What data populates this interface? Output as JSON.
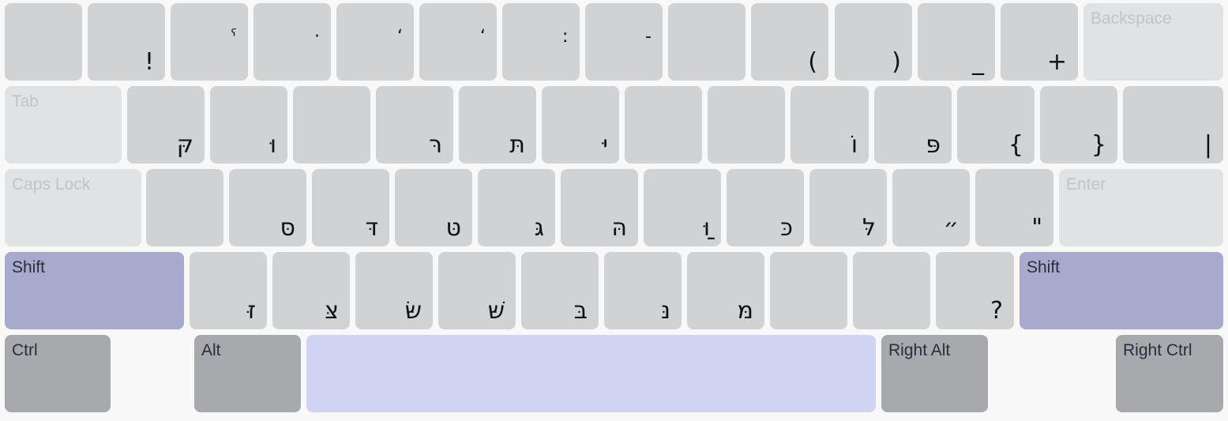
{
  "keyboard": {
    "colors": {
      "background": "#f8f8f8",
      "key": "#d1d2d4",
      "function_key": "#e1e2e4",
      "shift_key": "#a8aacd",
      "modifier_key": "#a8a9ac",
      "space_key": "#d0d3f1"
    },
    "rows": [
      {
        "name": "number-row",
        "keys": [
          {
            "char": ""
          },
          {
            "char": "!"
          },
          {
            "char": "ˁ"
          },
          {
            "char": "·"
          },
          {
            "char": "ʻ"
          },
          {
            "char": "ʻ"
          },
          {
            "char": "ː"
          },
          {
            "char": "-"
          },
          {
            "char": ""
          },
          {
            "char": "("
          },
          {
            "char": ")"
          },
          {
            "char": "_"
          },
          {
            "char": "+"
          },
          {
            "label": "Backspace"
          }
        ]
      },
      {
        "name": "top-row",
        "keys": [
          {
            "label": "Tab"
          },
          {
            "char": "קּ"
          },
          {
            "char": "וּ"
          },
          {
            "char": ""
          },
          {
            "char": "רּ"
          },
          {
            "char": "תּ"
          },
          {
            "char": "יּ"
          },
          {
            "char": ""
          },
          {
            "char": ""
          },
          {
            "char": "ֹו"
          },
          {
            "char": "פּ"
          },
          {
            "char": "{"
          },
          {
            "char": "}"
          },
          {
            "char": "|"
          }
        ]
      },
      {
        "name": "home-row",
        "keys": [
          {
            "label": "Caps Lock"
          },
          {
            "char": ""
          },
          {
            "char": "סּ"
          },
          {
            "char": "דּ"
          },
          {
            "char": "טּ"
          },
          {
            "char": "גּ"
          },
          {
            "char": "הּ"
          },
          {
            "char": "ַוּ"
          },
          {
            "char": "כּ"
          },
          {
            "char": "לּ"
          },
          {
            "char": "״"
          },
          {
            "char": "\""
          },
          {
            "label": "Enter"
          }
        ]
      },
      {
        "name": "bottom-row",
        "keys": [
          {
            "label": "Shift"
          },
          {
            "char": "זּ"
          },
          {
            "char": "צּ"
          },
          {
            "char": "שּׂ"
          },
          {
            "char": "שּׁ"
          },
          {
            "char": "בּ"
          },
          {
            "char": "נּ"
          },
          {
            "char": "מּ"
          },
          {
            "char": ""
          },
          {
            "char": ""
          },
          {
            "char": "?"
          },
          {
            "label": "Shift"
          }
        ]
      },
      {
        "name": "modifier-row",
        "keys": [
          {
            "label": "Ctrl"
          },
          {
            "label": "Alt"
          },
          {
            "label": ""
          },
          {
            "label": "Right Alt"
          },
          {
            "label": "Right Ctrl"
          }
        ]
      }
    ]
  }
}
